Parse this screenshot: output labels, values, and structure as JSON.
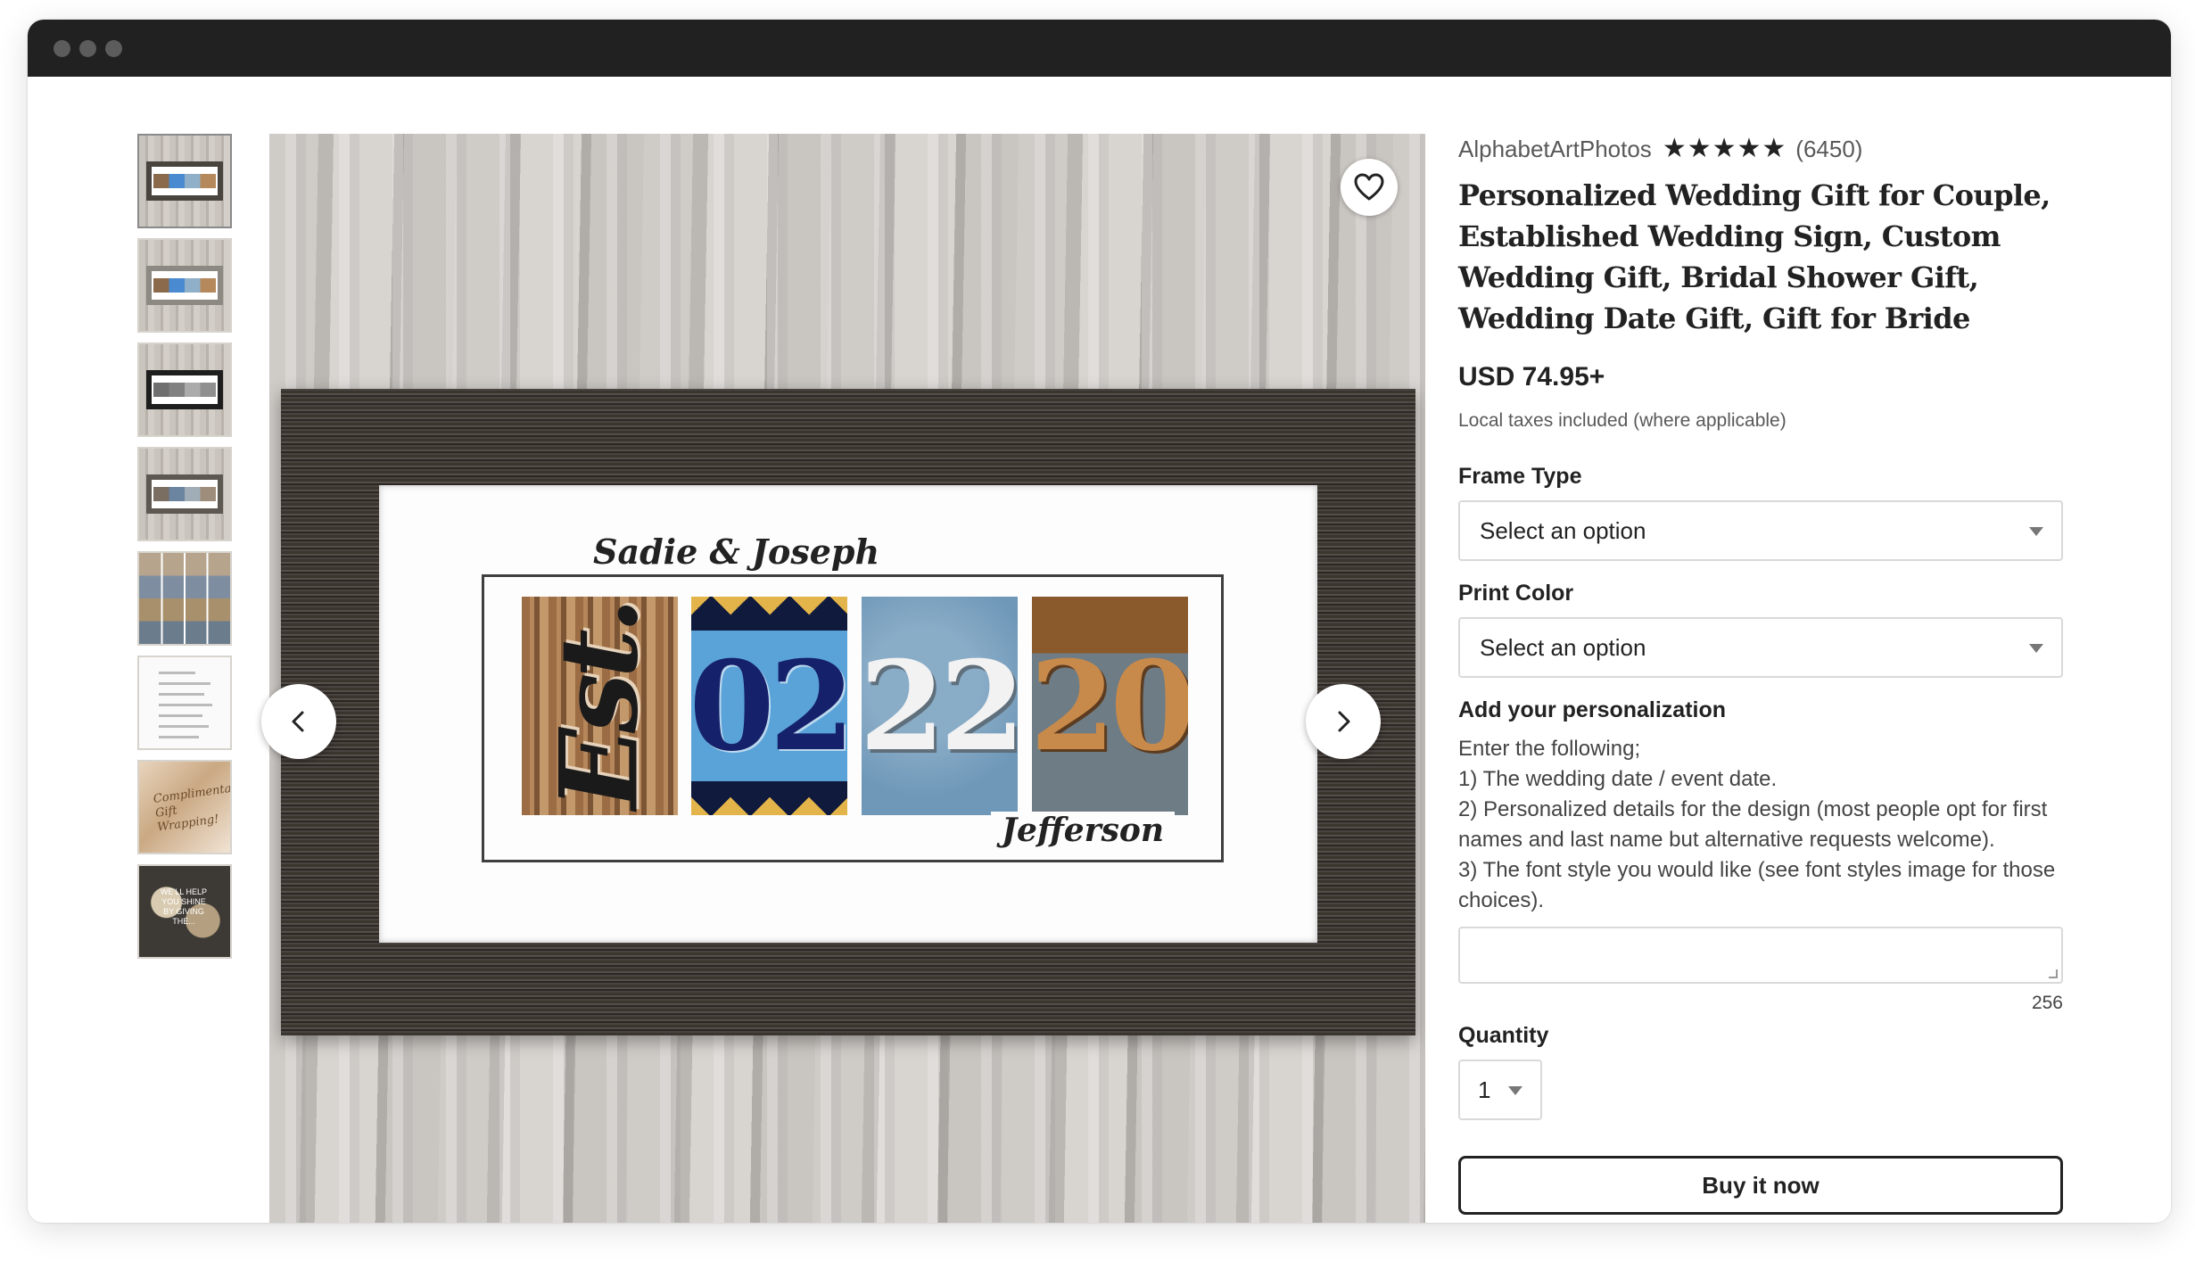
{
  "window": {
    "traffic_lights": [
      "close",
      "minimize",
      "maximize"
    ]
  },
  "gallery": {
    "thumbnails": [
      {
        "name": "thumb-est-date-frame",
        "selected": true
      },
      {
        "name": "thumb-rustic-frame"
      },
      {
        "name": "thumb-black-white-frame"
      },
      {
        "name": "thumb-espresso-frame"
      },
      {
        "name": "thumb-number-tile-grid"
      },
      {
        "name": "thumb-font-styles-list"
      },
      {
        "name": "thumb-gift-wrapping"
      },
      {
        "name": "thumb-customer-photo"
      }
    ],
    "hero_print": {
      "names_top": "Sadie & Joseph",
      "tiles": [
        "Est.",
        "02",
        "22",
        "20"
      ],
      "name_bottom": "Jefferson"
    }
  },
  "product": {
    "shop_name": "AlphabetArtPhotos",
    "rating_stars": "★★★★★",
    "rating_value": 5,
    "review_count": "(6450)",
    "title": "Personalized Wedding Gift for Couple, Established Wedding Sign, Custom Wedding Gift, Bridal Shower Gift, Wedding Date Gift, Gift for Bride",
    "price": "USD 74.95+",
    "tax_note": "Local taxes included (where applicable)",
    "frame_type": {
      "label": "Frame Type",
      "value": "Select an option"
    },
    "print_color": {
      "label": "Print Color",
      "value": "Select an option"
    },
    "personalization": {
      "label": "Add your personalization",
      "lines": [
        "Enter the following;",
        "1) The wedding date / event date.",
        "2) Personalized details for the design (most people opt for first names and last name but alternative requests welcome).",
        "3) The font style you would like (see font styles image for those choices)."
      ],
      "value": "",
      "char_limit": "256"
    },
    "quantity": {
      "label": "Quantity",
      "value": "1"
    },
    "buy_button": "Buy it now"
  },
  "colors": {
    "titlebar": "#212121",
    "text": "#222222",
    "muted": "#595959",
    "border": "#d9d9d9"
  },
  "icons": [
    "heart-icon",
    "chevron-left-icon",
    "chevron-right-icon",
    "caret-down-icon",
    "star-icon",
    "resize-handle-icon"
  ]
}
